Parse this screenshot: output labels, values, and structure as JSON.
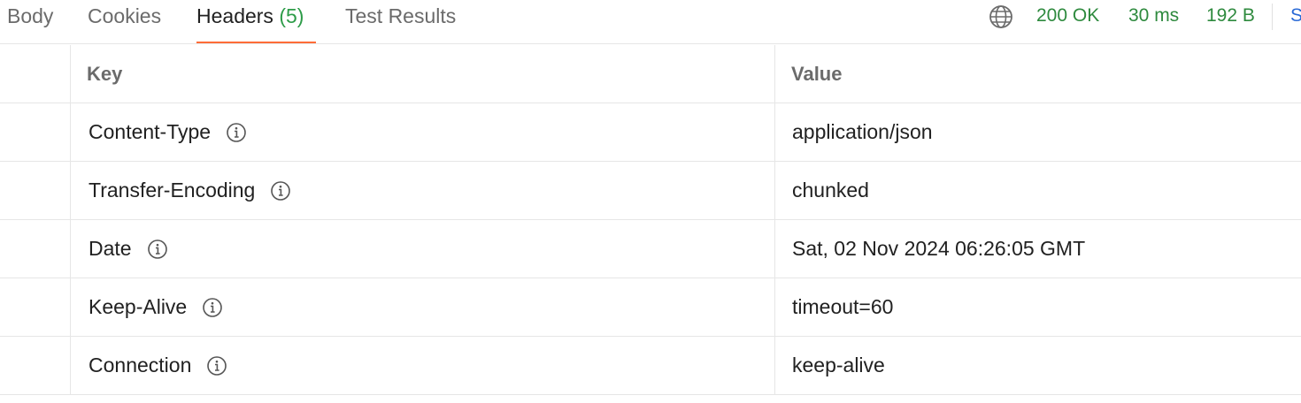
{
  "tabs": [
    {
      "label": "Body",
      "count": ""
    },
    {
      "label": "Cookies",
      "count": ""
    },
    {
      "label": "Headers",
      "count": "(5)"
    },
    {
      "label": "Test Results",
      "count": ""
    }
  ],
  "active_tab": "Headers",
  "status": {
    "code": "200 OK",
    "time": "30 ms",
    "size": "192 B",
    "save_partial": "S"
  },
  "colors": {
    "accent": "#ff6c37",
    "status_green": "#2e8a3e",
    "count_green": "#2e9c49",
    "link_blue": "#2869d6"
  },
  "table": {
    "columns": {
      "key": "Key",
      "value": "Value"
    },
    "rows": [
      {
        "key": "Content-Type",
        "value": "application/json"
      },
      {
        "key": "Transfer-Encoding",
        "value": "chunked"
      },
      {
        "key": "Date",
        "value": "Sat, 02 Nov 2024 06:26:05 GMT"
      },
      {
        "key": "Keep-Alive",
        "value": "timeout=60"
      },
      {
        "key": "Connection",
        "value": "keep-alive"
      }
    ]
  },
  "icons": {
    "network": "globe-icon",
    "header_info": "info-icon"
  }
}
